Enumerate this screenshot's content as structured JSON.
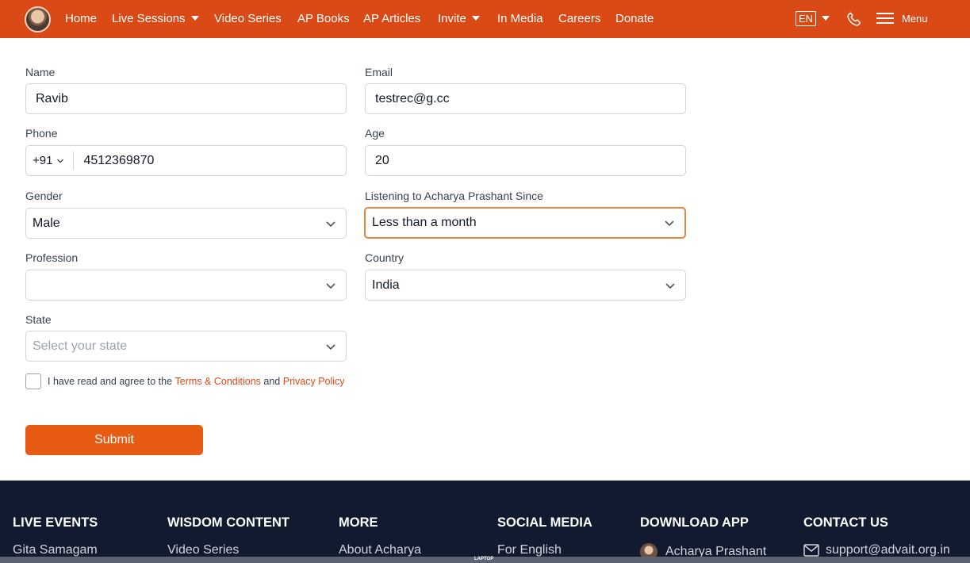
{
  "nav": {
    "links": [
      "Home",
      "Live Sessions",
      "Video Series",
      "AP Books",
      "AP Articles",
      "Invite",
      "In Media",
      "Careers",
      "Donate"
    ],
    "lang": "EN",
    "menu_label": "Menu"
  },
  "form": {
    "name": {
      "label": "Name",
      "value": "Ravib"
    },
    "email": {
      "label": "Email",
      "value": "testrec@g.cc"
    },
    "phone": {
      "label": "Phone",
      "country_code": "+91",
      "value": "4512369870"
    },
    "age": {
      "label": "Age",
      "value": "20"
    },
    "gender": {
      "label": "Gender",
      "value": "Male"
    },
    "listening": {
      "label": "Listening to Acharya Prashant Since",
      "value": "Less than a month"
    },
    "profession": {
      "label": "Profession",
      "value": ""
    },
    "country": {
      "label": "Country",
      "value": "India"
    },
    "state": {
      "label": "State",
      "placeholder": "Select your state"
    },
    "agree": {
      "prefix": "I have read and agree to the",
      "terms": "Terms & Conditions",
      "and": "and",
      "privacy": "Privacy Policy"
    },
    "submit_label": "Submit"
  },
  "footer": {
    "columns": [
      {
        "heading": "LIVE EVENTS",
        "item": "Gita Samagam"
      },
      {
        "heading": "WISDOM CONTENT",
        "item": "Video Series"
      },
      {
        "heading": "MORE",
        "item": "About Acharya"
      },
      {
        "heading": "SOCIAL MEDIA",
        "item": "For English"
      },
      {
        "heading": "DOWNLOAD APP",
        "item": "Acharya Prashant"
      },
      {
        "heading": "CONTACT US",
        "item": "support@advait.org.in"
      }
    ],
    "bottom_tag": "LAPTOP"
  },
  "colors": {
    "brand": "#d94a17",
    "submit": "#e85b12",
    "focus": "#e8853f",
    "footer": "#111a2e"
  }
}
